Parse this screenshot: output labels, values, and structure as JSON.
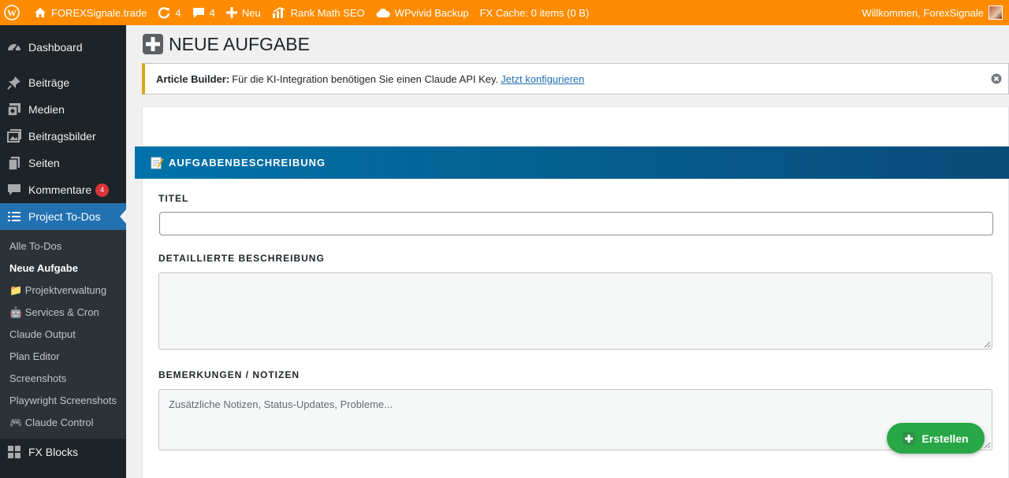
{
  "adminbar": {
    "site_name": "FOREXSignale.trade",
    "updates_count": "4",
    "comments_count": "4",
    "new_label": "Neu",
    "rankmath_label": "Rank Math SEO",
    "wpvivid_label": "WPvivid Backup",
    "fx_cache_label": "FX Cache: 0 items (0 B)",
    "greeting": "Willkommen, ForexSignale"
  },
  "sidebar": {
    "items": [
      {
        "label": "Dashboard",
        "icon": "dashboard-icon"
      },
      {
        "label": "Beiträge",
        "icon": "pin-icon"
      },
      {
        "label": "Medien",
        "icon": "media-icon"
      },
      {
        "label": "Beitragsbilder",
        "icon": "images-icon"
      },
      {
        "label": "Seiten",
        "icon": "pages-icon"
      },
      {
        "label": "Kommentare",
        "icon": "comments-icon",
        "badge": "4"
      },
      {
        "label": "Project To-Dos",
        "icon": "list-icon",
        "current": true
      }
    ],
    "submenu": [
      "Alle To-Dos",
      "Neue Aufgabe",
      "📁 Projektverwaltung",
      "🤖 Services & Cron",
      "Claude Output",
      "Plan Editor",
      "Screenshots",
      "Playwright Screenshots",
      "🎮 Claude Control"
    ],
    "active_submenu": "Neue Aufgabe",
    "bottom_item": {
      "label": "FX Blocks",
      "icon": "blocks-icon"
    }
  },
  "page": {
    "title": "NEUE AUFGABE"
  },
  "notice": {
    "strong": "Article Builder:",
    "text": "Für die KI-Integration benötigen Sie einen Claude API Key.",
    "link": "Jetzt konfigurieren"
  },
  "form": {
    "section_title": "AUFGABENBESCHREIBUNG",
    "title_label": "TITEL",
    "title_value": "",
    "description_label": "DETAILLIERTE BESCHREIBUNG",
    "description_value": "",
    "notes_label": "BEMERKUNGEN / NOTIZEN",
    "notes_placeholder": "Zusätzliche Notizen, Status-Updates, Probleme...",
    "submit_label": "Erstellen"
  },
  "colors": {
    "adminbar": "#ff8c00",
    "sidebar": "#1d2327",
    "accent": "#2271b1",
    "section_head": "#0073aa",
    "notice_border": "#dba617",
    "submit": "#27a745",
    "badge": "#d63638"
  }
}
